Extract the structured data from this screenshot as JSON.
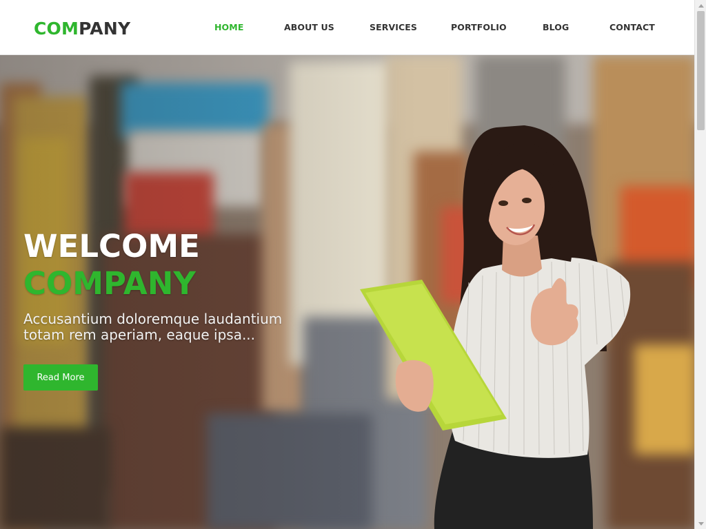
{
  "header": {
    "logo_part1": "COM",
    "logo_part2": "PANY",
    "nav": [
      {
        "label": "HOME",
        "active": true
      },
      {
        "label": "ABOUT US",
        "active": false
      },
      {
        "label": "SERVICES",
        "active": false
      },
      {
        "label": "PORTFOLIO",
        "active": false
      },
      {
        "label": "BLOG",
        "active": false
      },
      {
        "label": "CONTACT",
        "active": false
      }
    ]
  },
  "hero": {
    "title_line1": "WELCOME",
    "title_line2": "COMPANY",
    "subtitle": "Accusantium doloremque laudantium totam rem aperiam, eaque ipsa...",
    "button_label": "Read More"
  },
  "colors": {
    "accent": "#2fb62e",
    "text_dark": "#333333",
    "header_bg": "#ffffff",
    "scrollbar_thumb": "#c1c1c1"
  }
}
